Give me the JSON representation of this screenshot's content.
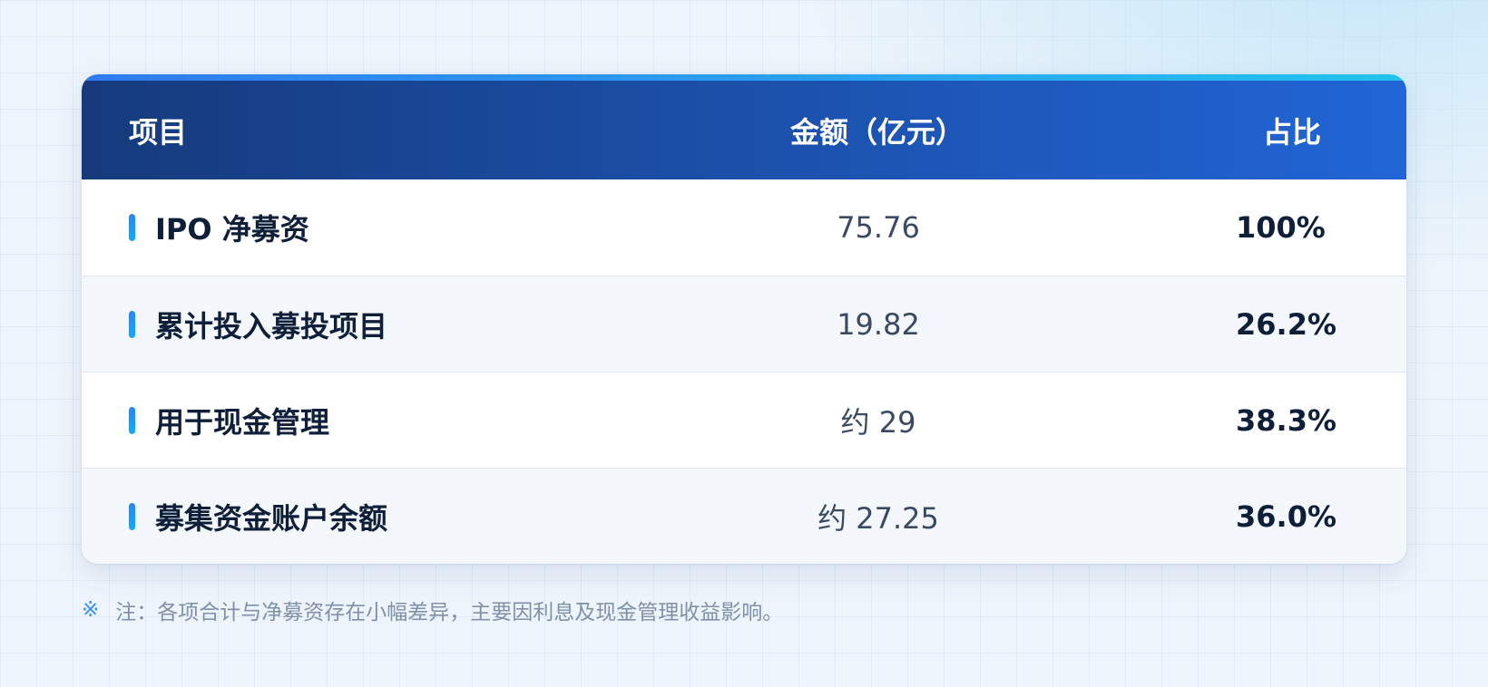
{
  "table": {
    "columns": {
      "item": "项目",
      "amount": "金额（亿元）",
      "ratio": "占比"
    },
    "rows": [
      {
        "item": "IPO 净募资",
        "amount": "75.76",
        "ratio": "100%"
      },
      {
        "item": "累计投入募投项目",
        "amount": "19.82",
        "ratio": "26.2%"
      },
      {
        "item": "用于现金管理",
        "amount": "约 29",
        "ratio": "38.3%"
      },
      {
        "item": "募集资金账户余额",
        "amount": "约 27.25",
        "ratio": "36.0%"
      }
    ]
  },
  "note": {
    "icon": "※",
    "text": "注：各项合计与净募资存在小幅差异，主要因利息及现金管理收益影响。"
  },
  "colors": {
    "header_start": "#163a7c",
    "header_end": "#2165d6",
    "accent": "#2e83f0"
  }
}
